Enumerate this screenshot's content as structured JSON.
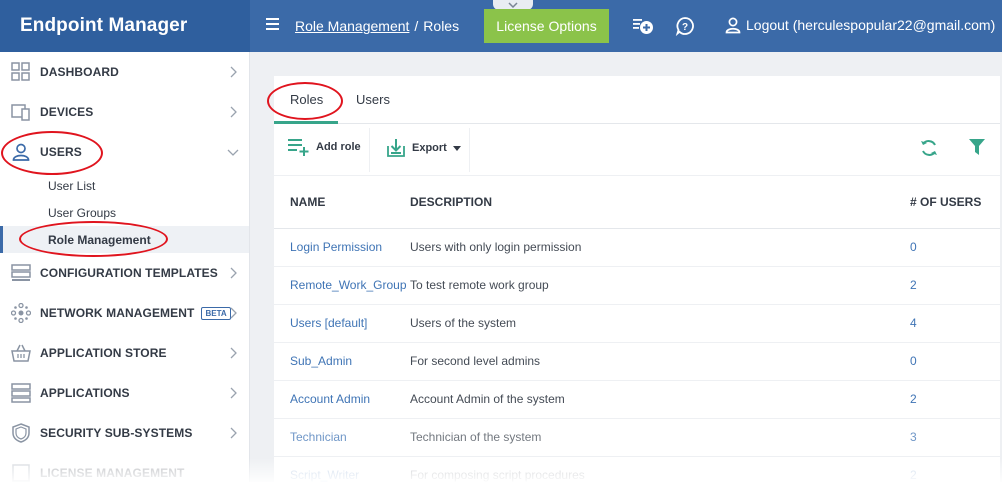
{
  "app": {
    "title": "Endpoint Manager"
  },
  "breadcrumb": {
    "parent": "Role Management",
    "current": "Roles"
  },
  "header": {
    "license_button": "License Options",
    "logout_label": "Logout (herculespopular22@gmail.com)"
  },
  "sidebar": {
    "items": [
      {
        "label": "DASHBOARD",
        "icon": "dashboard-icon"
      },
      {
        "label": "DEVICES",
        "icon": "devices-icon"
      },
      {
        "label": "USERS",
        "icon": "user-icon"
      },
      {
        "label": "CONFIGURATION TEMPLATES",
        "icon": "templates-icon"
      },
      {
        "label": "NETWORK MANAGEMENT",
        "icon": "network-icon",
        "badge": "BETA"
      },
      {
        "label": "APPLICATION STORE",
        "icon": "basket-icon"
      },
      {
        "label": "APPLICATIONS",
        "icon": "applications-icon"
      },
      {
        "label": "SECURITY SUB-SYSTEMS",
        "icon": "shield-icon"
      },
      {
        "label": "LICENSE MANAGEMENT",
        "icon": "license-icon"
      }
    ],
    "users_subitems": [
      {
        "label": "User List"
      },
      {
        "label": "User Groups"
      },
      {
        "label": "Role Management"
      }
    ]
  },
  "tabs": [
    {
      "label": "Roles"
    },
    {
      "label": "Users"
    }
  ],
  "toolbar": {
    "add_role": "Add role",
    "export": "Export"
  },
  "table": {
    "headers": {
      "name": "NAME",
      "description": "DESCRIPTION",
      "users": "# OF USERS"
    },
    "rows": [
      {
        "name": "Login Permission",
        "description": "Users with only login permission",
        "count": "0"
      },
      {
        "name": "Remote_Work_Group",
        "description": "To test remote work group",
        "count": "2"
      },
      {
        "name": "Users [default]",
        "description": "Users of the system",
        "count": "4"
      },
      {
        "name": "Sub_Admin",
        "description": "For second level admins",
        "count": "0"
      },
      {
        "name": "Account Admin",
        "description": "Account Admin of the system",
        "count": "2"
      },
      {
        "name": "Technician",
        "description": "Technician of the system",
        "count": "3"
      },
      {
        "name": "Script_Writer",
        "description": "For composing script procedures",
        "count": "2"
      }
    ]
  },
  "colors": {
    "header_blue": "#3b6aa8",
    "brand_blue": "#2f5f9e",
    "license_green": "#8bc34a",
    "accent_teal": "#37a58a",
    "link_blue": "#3f74b5",
    "annotation_red": "#e0141e"
  }
}
